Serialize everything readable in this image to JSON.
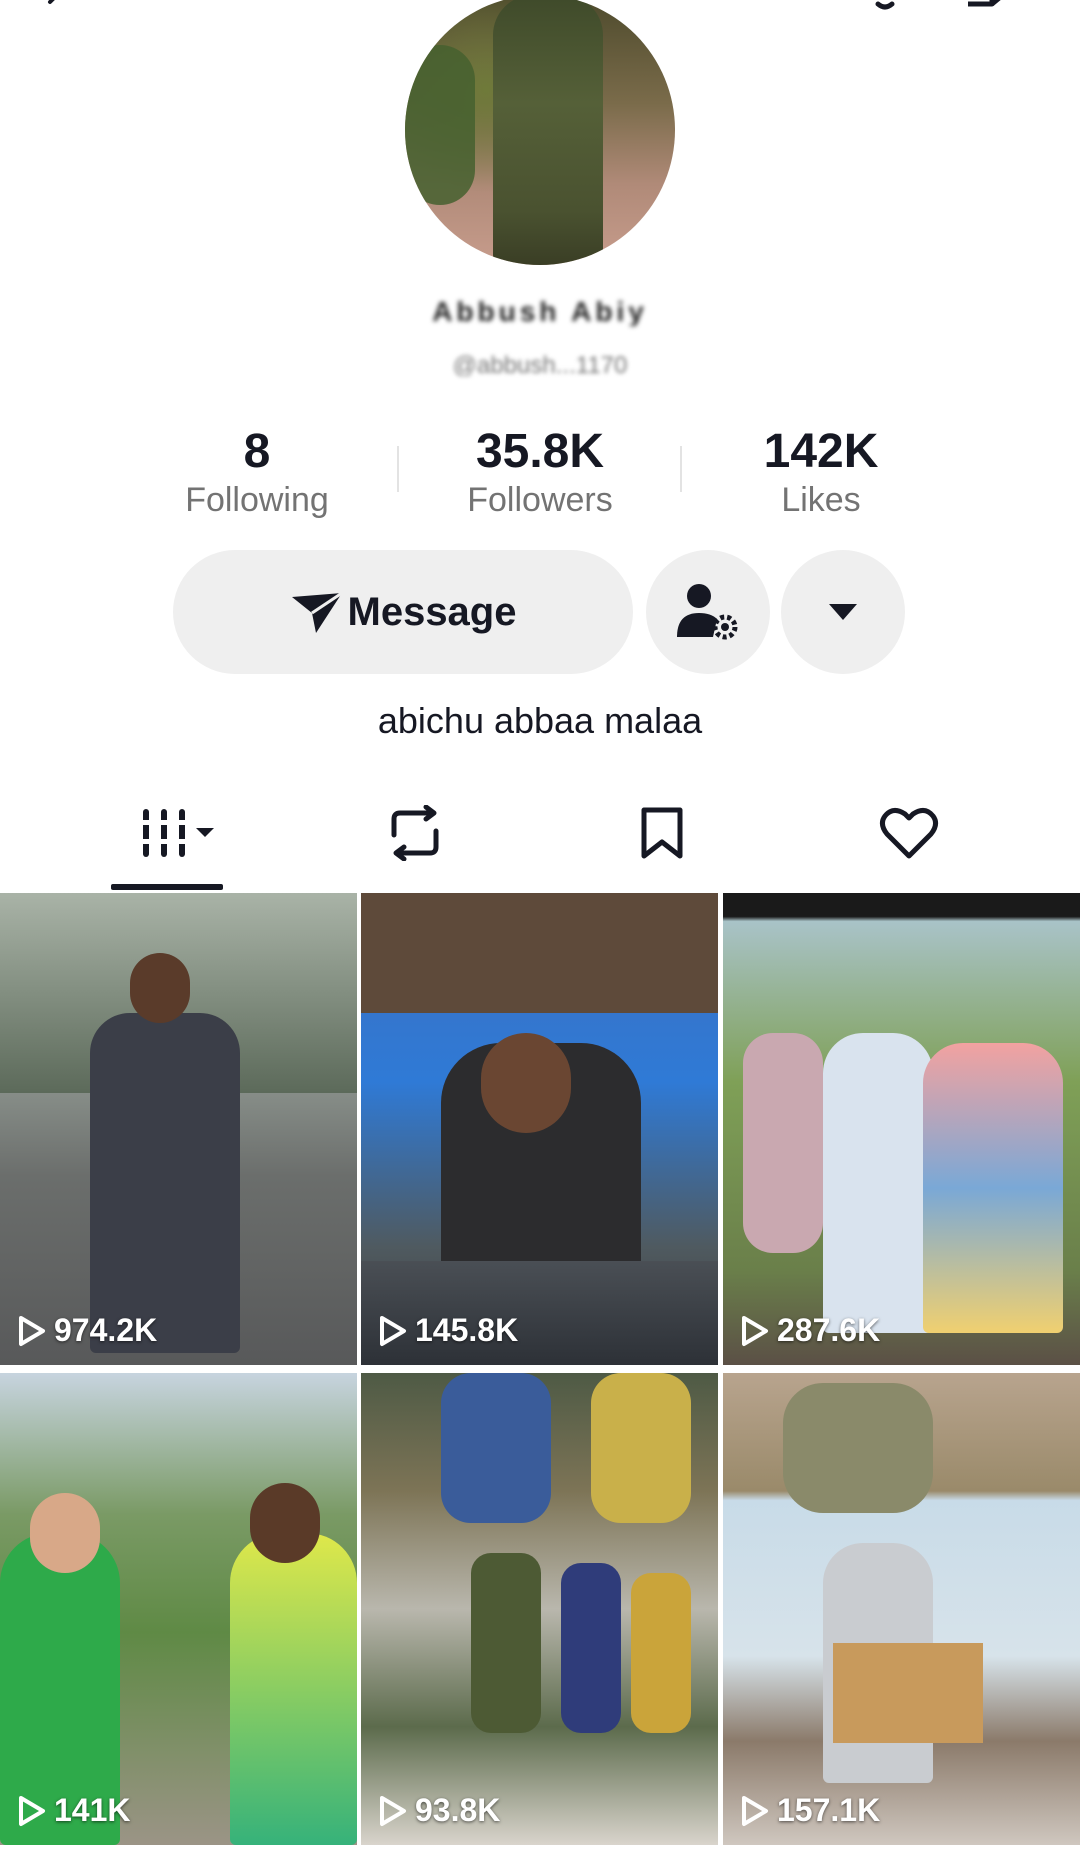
{
  "profile": {
    "display_name": "Abbush Abiy",
    "username": "@abbush...1170",
    "stats": [
      {
        "value": "8",
        "label": "Following"
      },
      {
        "value": "35.8K",
        "label": "Followers"
      },
      {
        "value": "142K",
        "label": "Likes"
      }
    ],
    "bio": "abichu abbaa malaa"
  },
  "actions": {
    "message_label": "Message"
  },
  "videos": [
    {
      "views": "974.2K"
    },
    {
      "views": "145.8K"
    },
    {
      "views": "287.6K"
    },
    {
      "views": "141K"
    },
    {
      "views": "93.8K"
    },
    {
      "views": "157.1K"
    }
  ],
  "icons": {
    "back": "back-icon",
    "bell": "bell-icon",
    "share": "share-icon",
    "message": "paper-plane-icon",
    "add_friend": "person-gear-icon",
    "more": "caret-down-icon",
    "tab_videos": "grid-icon",
    "tab_reposts": "repost-icon",
    "tab_saved": "bookmark-icon",
    "tab_liked": "heart-icon"
  },
  "colors": {
    "text": "#161823",
    "secondary_text": "#737373",
    "button_bg": "#efefef"
  }
}
